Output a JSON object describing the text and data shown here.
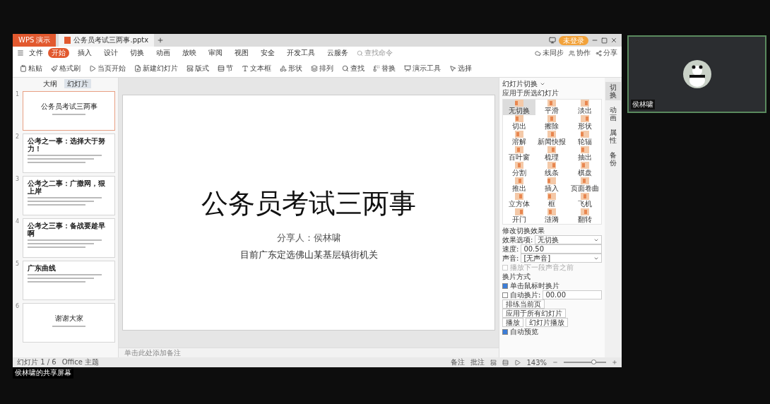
{
  "title_bar": {
    "app_tab": "WPS 演示",
    "document_tab": "公务员考试三两事.pptx",
    "account": "未登录"
  },
  "menu": {
    "file": "文件",
    "tabs": [
      {
        "label": "开始",
        "selected": true
      },
      {
        "label": "插入",
        "selected": false
      },
      {
        "label": "设计",
        "selected": false
      },
      {
        "label": "切换",
        "selected": false
      },
      {
        "label": "动画",
        "selected": false
      },
      {
        "label": "放映",
        "selected": false
      },
      {
        "label": "审阅",
        "selected": false
      },
      {
        "label": "视图",
        "selected": false
      },
      {
        "label": "安全",
        "selected": false
      },
      {
        "label": "开发工具",
        "selected": false
      },
      {
        "label": "云服务",
        "selected": false
      }
    ],
    "search": {
      "placeholder": "查找命令"
    },
    "actions": [
      "未同步",
      "协作",
      "分享"
    ]
  },
  "ribbon": [
    "粘贴",
    "格式刷",
    "当页开始",
    "新建幻灯片",
    "版式",
    "节",
    "文本框",
    "形状",
    "排列",
    "查找",
    "替换",
    "演示工具",
    "选择"
  ],
  "slide_panel": {
    "tabs": [
      {
        "label": "大纲",
        "selected": false
      },
      {
        "label": "幻灯片",
        "selected": true
      }
    ],
    "slides": [
      {
        "number": "1",
        "kind": "title",
        "title": "公务员考试三两事",
        "selected": true
      },
      {
        "number": "2",
        "kind": "content",
        "title": "公考之一事：选择大于努力！",
        "selected": false
      },
      {
        "number": "3",
        "kind": "content",
        "title": "公考之二事：广撒网，狠上岸",
        "selected": false
      },
      {
        "number": "4",
        "kind": "content",
        "title": "公考之三事：备战要趁早啊",
        "selected": false
      },
      {
        "number": "5",
        "kind": "content",
        "title": "广东曲线",
        "selected": false
      },
      {
        "number": "6",
        "kind": "title",
        "title": "谢谢大家",
        "selected": false
      }
    ]
  },
  "slide": {
    "title": "公务员考试三两事",
    "presenter": "分享人：侯林啸",
    "subtitle": "目前广东定选佛山某基层镇街机关"
  },
  "notes": {
    "placeholder": "单击此处添加备注"
  },
  "transition_panel": {
    "title": "幻灯片切换",
    "subtitle": "应用于所选幻灯片",
    "effects": [
      {
        "label": "无切换",
        "selected": true
      },
      {
        "label": "平滑",
        "selected": false
      },
      {
        "label": "淡出",
        "selected": false
      },
      {
        "label": "切出",
        "selected": false
      },
      {
        "label": "擦除",
        "selected": false
      },
      {
        "label": "形状",
        "selected": false
      },
      {
        "label": "溶解",
        "selected": false
      },
      {
        "label": "新闻快报",
        "selected": false
      },
      {
        "label": "轮辐",
        "selected": false
      },
      {
        "label": "百叶窗",
        "selected": false
      },
      {
        "label": "梳理",
        "selected": false
      },
      {
        "label": "抽出",
        "selected": false
      },
      {
        "label": "分割",
        "selected": false
      },
      {
        "label": "线条",
        "selected": false
      },
      {
        "label": "棋盘",
        "selected": false
      },
      {
        "label": "推出",
        "selected": false
      },
      {
        "label": "插入",
        "selected": false
      },
      {
        "label": "页面卷曲",
        "selected": false
      },
      {
        "label": "立方体",
        "selected": false
      },
      {
        "label": "框",
        "selected": false
      },
      {
        "label": "飞机",
        "selected": false
      },
      {
        "label": "开门",
        "selected": false
      },
      {
        "label": "涟漪",
        "selected": false
      },
      {
        "label": "翻转",
        "selected": false
      }
    ],
    "modify_title": "修改切换效果",
    "effect_label": "效果选项:",
    "effect_value": "无切换",
    "speed_label": "速度:",
    "speed_value": "00.50",
    "sound_label": "声音:",
    "sound_value": "[无声音]",
    "loop": {
      "label": "播放下一段声音之前",
      "checked": false,
      "disabled": true
    },
    "advance_title": "换片方式",
    "on_click": {
      "label": "单击鼠标时换片",
      "checked": true
    },
    "auto": {
      "label": "自动换片:",
      "checked": false,
      "value": "00.00"
    },
    "buttons": [
      "排练当前页",
      "应用于所有幻灯片"
    ],
    "play": "播放",
    "slideshow": "幻灯片播放",
    "preview": {
      "label": "自动预览",
      "checked": true
    }
  },
  "side_tabs": [
    {
      "label": "切换",
      "selected": true
    },
    {
      "label": "动画",
      "selected": false
    },
    {
      "label": "属性",
      "selected": false
    },
    {
      "label": "备份",
      "selected": false
    }
  ],
  "status_bar": {
    "slide_count": "幻灯片 1 / 6",
    "theme": "Office 主题",
    "notes": "备注",
    "comments": "批注",
    "zoom": "143%",
    "zoom_level": {
      "level": 0.7
    }
  },
  "share_label": "侯林啸的共享屏幕",
  "participant": {
    "name": "侯林啸"
  }
}
